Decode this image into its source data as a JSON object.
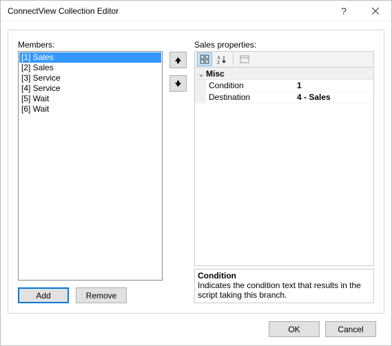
{
  "window": {
    "title": "ConnectView Collection Editor"
  },
  "left": {
    "label": "Members:",
    "items": [
      {
        "text": "[1] Sales",
        "selected": true
      },
      {
        "text": "[2] Sales",
        "selected": false
      },
      {
        "text": "[3] Service",
        "selected": false
      },
      {
        "text": "[4] Service",
        "selected": false
      },
      {
        "text": "[5] Wait",
        "selected": false
      },
      {
        "text": "[6] Wait",
        "selected": false
      }
    ],
    "add_label": "Add",
    "remove_label": "Remove"
  },
  "right": {
    "label": "Sales properties:",
    "category": "Misc",
    "properties": [
      {
        "name": "Condition",
        "value": "1",
        "value_bold": true
      },
      {
        "name": "Destination",
        "value": "4 - Sales",
        "value_bold": true
      }
    ],
    "description": {
      "name": "Condition",
      "text": "Indicates the condition text that results in the script taking this branch."
    }
  },
  "dialog": {
    "ok": "OK",
    "cancel": "Cancel"
  }
}
